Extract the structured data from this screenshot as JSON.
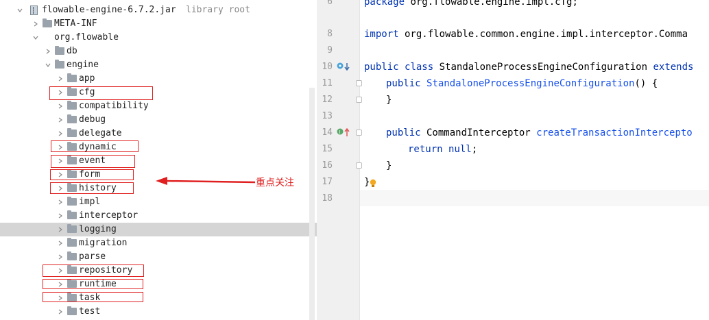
{
  "project_tree": {
    "root": {
      "label": "flowable-engine-6.7.2.jar",
      "hint": "library root"
    },
    "items": [
      {
        "label": "META-INF"
      },
      {
        "label": "org.flowable"
      },
      {
        "label": "db"
      },
      {
        "label": "engine"
      },
      {
        "label": "app"
      },
      {
        "label": "cfg"
      },
      {
        "label": "compatibility"
      },
      {
        "label": "debug"
      },
      {
        "label": "delegate"
      },
      {
        "label": "dynamic"
      },
      {
        "label": "event"
      },
      {
        "label": "form"
      },
      {
        "label": "history"
      },
      {
        "label": "impl"
      },
      {
        "label": "interceptor"
      },
      {
        "label": "logging"
      },
      {
        "label": "migration"
      },
      {
        "label": "parse"
      },
      {
        "label": "repository"
      },
      {
        "label": "runtime"
      },
      {
        "label": "task"
      },
      {
        "label": "test"
      }
    ],
    "selected": "logging"
  },
  "annotation": {
    "text": "重点关注",
    "color": "#e02020"
  },
  "editor": {
    "line_numbers": [
      "6",
      "8",
      "9",
      "10",
      "11",
      "12",
      "13",
      "14",
      "15",
      "16",
      "17",
      "18"
    ],
    "line6": {
      "kw": "package",
      "rest": " org.flowable.engine.impl.cfg;"
    },
    "line8": {
      "kw": "import",
      "rest": " org.flowable.common.engine.impl.interceptor.Comma"
    },
    "line10": {
      "kw1": "public",
      "kw2": "class",
      "name": " StandaloneProcessEngineConfiguration ",
      "kw3": "extends"
    },
    "line11": {
      "kw": "public",
      "fn": "StandaloneProcessEngineConfiguration",
      "rest": "() {"
    },
    "line12": "}",
    "line14": {
      "kw": "public",
      "type": " CommandInterceptor ",
      "fn": "createTransactionIntercepto"
    },
    "line15": {
      "kw1": "return",
      "kw2": "null",
      "rest": ";"
    },
    "line16": "}",
    "line17": "}"
  }
}
